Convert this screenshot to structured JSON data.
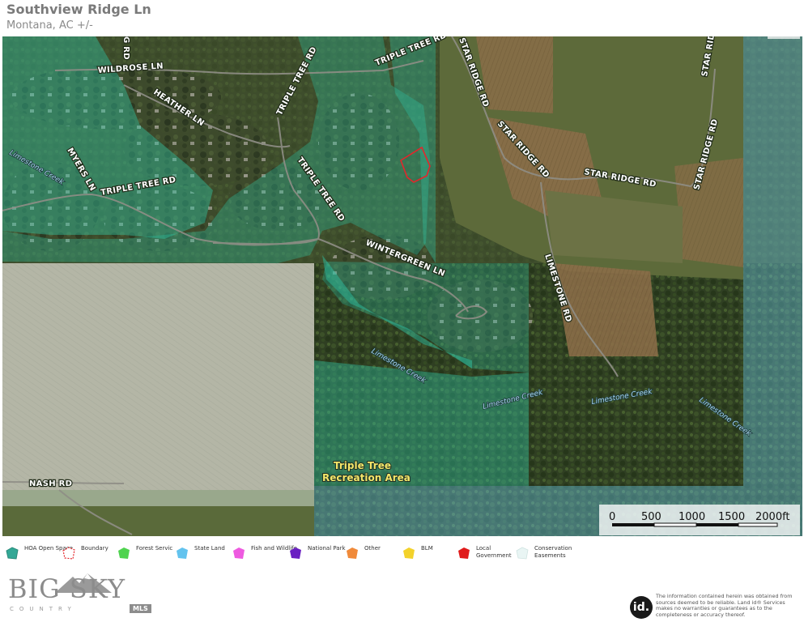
{
  "header": {
    "title": "Southview Ridge Ln",
    "subtitle": "Montana,  AC +/-"
  },
  "map": {
    "roads": [
      {
        "id": "wildrose",
        "label": "WILDROSE LN"
      },
      {
        "id": "g-rd",
        "label": "G RD"
      },
      {
        "id": "triple-tree-top",
        "label": "TRIPLE TREE RD"
      },
      {
        "id": "triple-tree-mid",
        "label": "TRIPLE TREE RD"
      },
      {
        "id": "heather",
        "label": "HEATHER LN"
      },
      {
        "id": "myers",
        "label": "MYERS LN"
      },
      {
        "id": "triple-tree-west",
        "label": "TRIPLE TREE RD"
      },
      {
        "id": "triple-tree-south",
        "label": "TRIPLE TREE RD"
      },
      {
        "id": "wintergreen",
        "label": "WINTERGREEN LN"
      },
      {
        "id": "star-ridge-top",
        "label": "STAR RIDGE RD"
      },
      {
        "id": "star-ridge-mid",
        "label": "STAR RIDGE RD"
      },
      {
        "id": "star-ridge-east",
        "label": "STAR RIDGE RD"
      },
      {
        "id": "star-ridge-ne",
        "label": "STAR RIDGE RD"
      },
      {
        "id": "star-ridge-far",
        "label": "STAR RIDGE"
      },
      {
        "id": "limestone-rd",
        "label": "LIMESTONE RD"
      },
      {
        "id": "nash",
        "label": "NASH RD"
      }
    ],
    "creeks": [
      {
        "id": "creek-west",
        "label": "Limestone Creek"
      },
      {
        "id": "creek-mid",
        "label": "Limestone Creek"
      },
      {
        "id": "creek-south",
        "label": "Limestone Creek"
      },
      {
        "id": "creek-se",
        "label": "Limestone Creek"
      },
      {
        "id": "creek-east",
        "label": "Limestone Creek"
      }
    ],
    "area_label": {
      "line1": "Triple Tree",
      "line2": "Recreation Area"
    },
    "scale_bar": {
      "ticks": [
        "0",
        "500",
        "1000",
        "1500",
        "2000ft"
      ]
    },
    "colors": {
      "hoa_open_space": "#2fc7a8",
      "state_land": "#6ed0f0",
      "boundary": "#e3262b",
      "conservation": "#e6f4f2"
    }
  },
  "legend": [
    {
      "label": "HOA Open Space",
      "color": "#33a896",
      "shape": "hoa-open-space-icon"
    },
    {
      "label": "Boundary",
      "color": "#e3262b",
      "shape": "boundary-icon"
    },
    {
      "label": "Forest Servic",
      "color": "#4fd34f",
      "shape": "forest-service-icon"
    },
    {
      "label": "State Land",
      "color": "#63c3ee",
      "shape": "state-land-icon"
    },
    {
      "label": "Fish and Wildlife",
      "color": "#ee5ae0",
      "shape": "fish-wildlife-icon"
    },
    {
      "label": "National Park",
      "color": "#6a1fc2",
      "shape": "national-park-icon"
    },
    {
      "label": "Other",
      "color": "#f08a3a",
      "shape": "other-icon"
    },
    {
      "label": "BLM",
      "color": "#f3d22b",
      "shape": "blm-icon"
    },
    {
      "label": "Local Government",
      "color": "#e01b1b",
      "shape": "local-government-icon"
    },
    {
      "label": "Conservation Easements",
      "color": "#e9f5f4",
      "shape": "conservation-easements-icon"
    }
  ],
  "footer": {
    "logo_text": "BIG SKY",
    "logo_sub": "COUNTRY",
    "logo_mls": "MLS",
    "id_badge": "id.",
    "disclaimer": "The information contained herein was obtained from sources deemed to be reliable. Land id® Services makes no warranties or guarantees as to the completeness or accuracy thereof."
  }
}
